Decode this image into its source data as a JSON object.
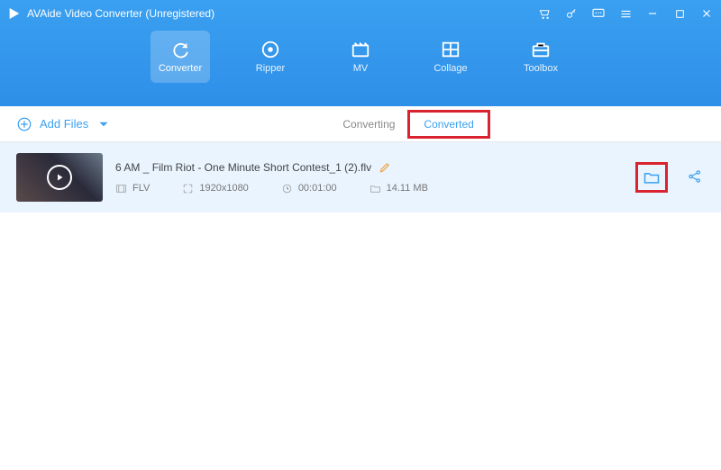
{
  "app": {
    "title": "AVAide Video Converter (Unregistered)"
  },
  "navTabs": {
    "converter": "Converter",
    "ripper": "Ripper",
    "mv": "MV",
    "collage": "Collage",
    "toolbox": "Toolbox"
  },
  "subbar": {
    "addFiles": "Add Files",
    "converting": "Converting",
    "converted": "Converted"
  },
  "item": {
    "filename": "6 AM _ Film Riot - One Minute Short Contest_1 (2).flv",
    "format": "FLV",
    "resolution": "1920x1080",
    "duration": "00:01:00",
    "size": "14.11 MB"
  },
  "colors": {
    "accent": "#3aa0f0",
    "highlight": "#d9232e"
  }
}
